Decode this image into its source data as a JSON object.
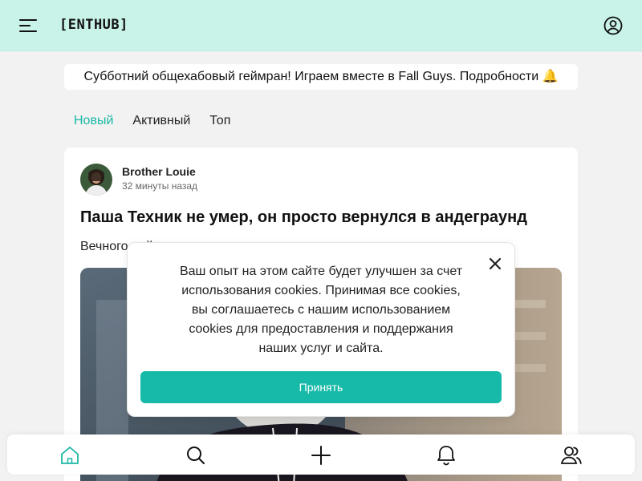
{
  "header": {
    "logo": "[ENTHUB]",
    "menu_icon": "hamburger-menu-icon",
    "profile_icon": "user-circle-icon"
  },
  "banner": {
    "text": "Субботний общехабовый геймран! Играем вместе в Fall Guys. Подробности 🔔"
  },
  "tabs": [
    {
      "label": "Новый",
      "active": true
    },
    {
      "label": "Активный",
      "active": false
    },
    {
      "label": "Топ",
      "active": false
    }
  ],
  "post": {
    "author": "Brother Louie",
    "time": "32 минуты назад",
    "title": "Паша Техник не умер, он просто вернулся в андеграунд",
    "excerpt": "Вечного ... й"
  },
  "cookie": {
    "text": "Ваш опыт на этом сайте будет улучшен за счет использования cookies. Принимая все cookies, вы соглашаетесь с нашим использованием cookies для предоставления и поддержания наших услуг и сайта.",
    "accept_label": "Принять",
    "close_icon": "close-icon"
  },
  "bottom_nav": [
    "home-icon",
    "search-icon",
    "plus-icon",
    "bell-icon",
    "users-icon"
  ],
  "colors": {
    "accent": "#19b8a6",
    "header_bg": "#c9f3e9",
    "page_bg": "#f1f2f1"
  }
}
